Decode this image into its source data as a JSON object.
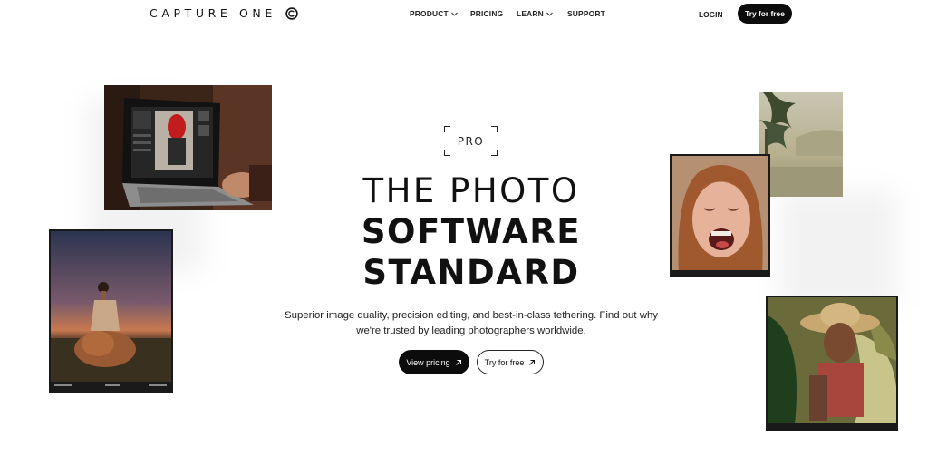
{
  "brand": {
    "name": "CAPTURE ONE",
    "logo_icon": "capture-one-logo-icon"
  },
  "nav": {
    "links": [
      {
        "label": "PRODUCT",
        "has_dropdown": true
      },
      {
        "label": "PRICING",
        "has_dropdown": false
      },
      {
        "label": "LEARN",
        "has_dropdown": true
      },
      {
        "label": "SUPPORT",
        "has_dropdown": false
      }
    ],
    "login_label": "LOGIN",
    "cta_label": "Try for free"
  },
  "hero": {
    "badge": "PRO",
    "headline_line1": "THE PHOTO",
    "headline_line2": "SOFTWARE",
    "headline_line3": "STANDARD",
    "subtitle": "Superior image quality, precision editing, and best-in-class tethering. Find out why we're trusted by leading photographers worldwide.",
    "primary_button": "View pricing",
    "secondary_button": "Try for free",
    "button_icon": "arrow-up-right-icon"
  },
  "photos": [
    {
      "subject": "laptop-editing-photo"
    },
    {
      "subject": "sunset-portrait-photo"
    },
    {
      "subject": "tropical-mist-photo"
    },
    {
      "subject": "laughing-woman-photo"
    },
    {
      "subject": "farmer-straw-hat-photo"
    }
  ],
  "colors": {
    "text": "#111111",
    "button_dark": "#0c0c0c",
    "background": "#ffffff"
  }
}
